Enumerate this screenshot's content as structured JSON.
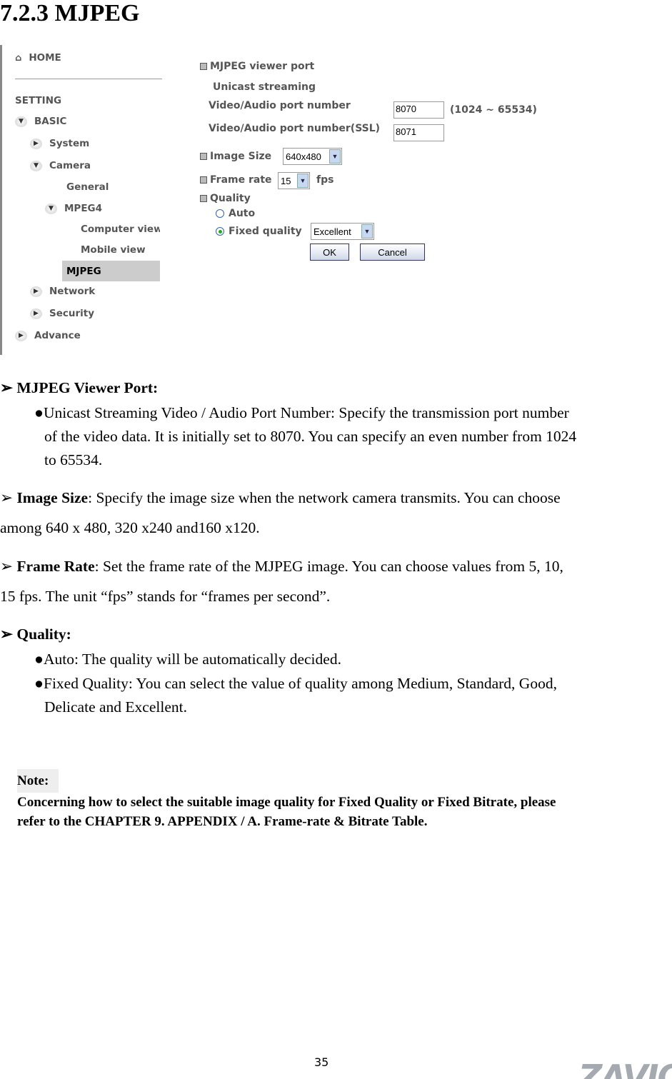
{
  "title": "7.2.3 MJPEG",
  "sidebar": {
    "home": "HOME",
    "setting": "SETTING",
    "items": [
      {
        "label": "BASIC",
        "icon": "chevron-down-icon"
      },
      {
        "label": "System",
        "icon": "chevron-right-icon"
      },
      {
        "label": "Camera",
        "icon": "chevron-down-icon"
      },
      {
        "label": "General"
      },
      {
        "label": "MPEG4",
        "icon": "chevron-down-icon"
      },
      {
        "label": "Computer view"
      },
      {
        "label": "Mobile view"
      },
      {
        "label": "MJPEG",
        "selected": true
      },
      {
        "label": "Network",
        "icon": "chevron-right-icon"
      },
      {
        "label": "Security",
        "icon": "chevron-right-icon"
      },
      {
        "label": "Advance",
        "icon": "chevron-right-icon"
      }
    ]
  },
  "form": {
    "viewer_port": "MJPEG viewer port",
    "unicast": "Unicast streaming",
    "port_label": "Video/Audio port number",
    "port_value": "8070",
    "port_range": "(1024 ~ 65534)",
    "ssl_label": "Video/Audio port number(SSL)",
    "ssl_value": "8071",
    "image_size_label": "Image Size",
    "image_size_value": "640x480",
    "frame_rate_label": "Frame rate",
    "frame_rate_value": "15",
    "fps": "fps",
    "quality_label": "Quality",
    "auto": "Auto",
    "fixed": "Fixed quality",
    "fixed_value": "Excellent",
    "ok": "OK",
    "cancel": "Cancel"
  },
  "doc": {
    "s1_title": "MJPEG Viewer Port:",
    "s1_b1_l1": "Unicast Streaming Video / Audio Port Number: Specify the transmission port number",
    "s1_b1_l2": "of the video data. It is initially set to 8070. You can specify an even number from 1024",
    "s1_b1_l3": "to 65534.",
    "s2_title": "Image Size",
    "s2_l1": ": Specify the image size when the network camera transmits. You can choose",
    "s2_l2": "among 640 x 480, 320 x240 and160 x120.",
    "s3_title": "Frame Rate",
    "s3_l1": ": Set the frame rate of the MJPEG image. You can choose values from 5, 10,",
    "s3_l2": "15 fps. The unit “fps” stands for “frames per second”.",
    "s4_title": "Quality:",
    "s4_b1": "Auto: The quality will be automatically decided.",
    "s4_b2_l1": "Fixed Quality: You can select the value of quality among Medium, Standard, Good,",
    "s4_b2_l2": "Delicate and Excellent.",
    "note_title": "Note:",
    "note_l1": "Concerning how to select the suitable image quality for Fixed Quality or Fixed Bitrate, please",
    "note_l2": "refer to the CHAPTER 9. APPENDIX / A. Frame-rate & Bitrate Table."
  },
  "page_number": "35",
  "logo": "ZAVIO"
}
